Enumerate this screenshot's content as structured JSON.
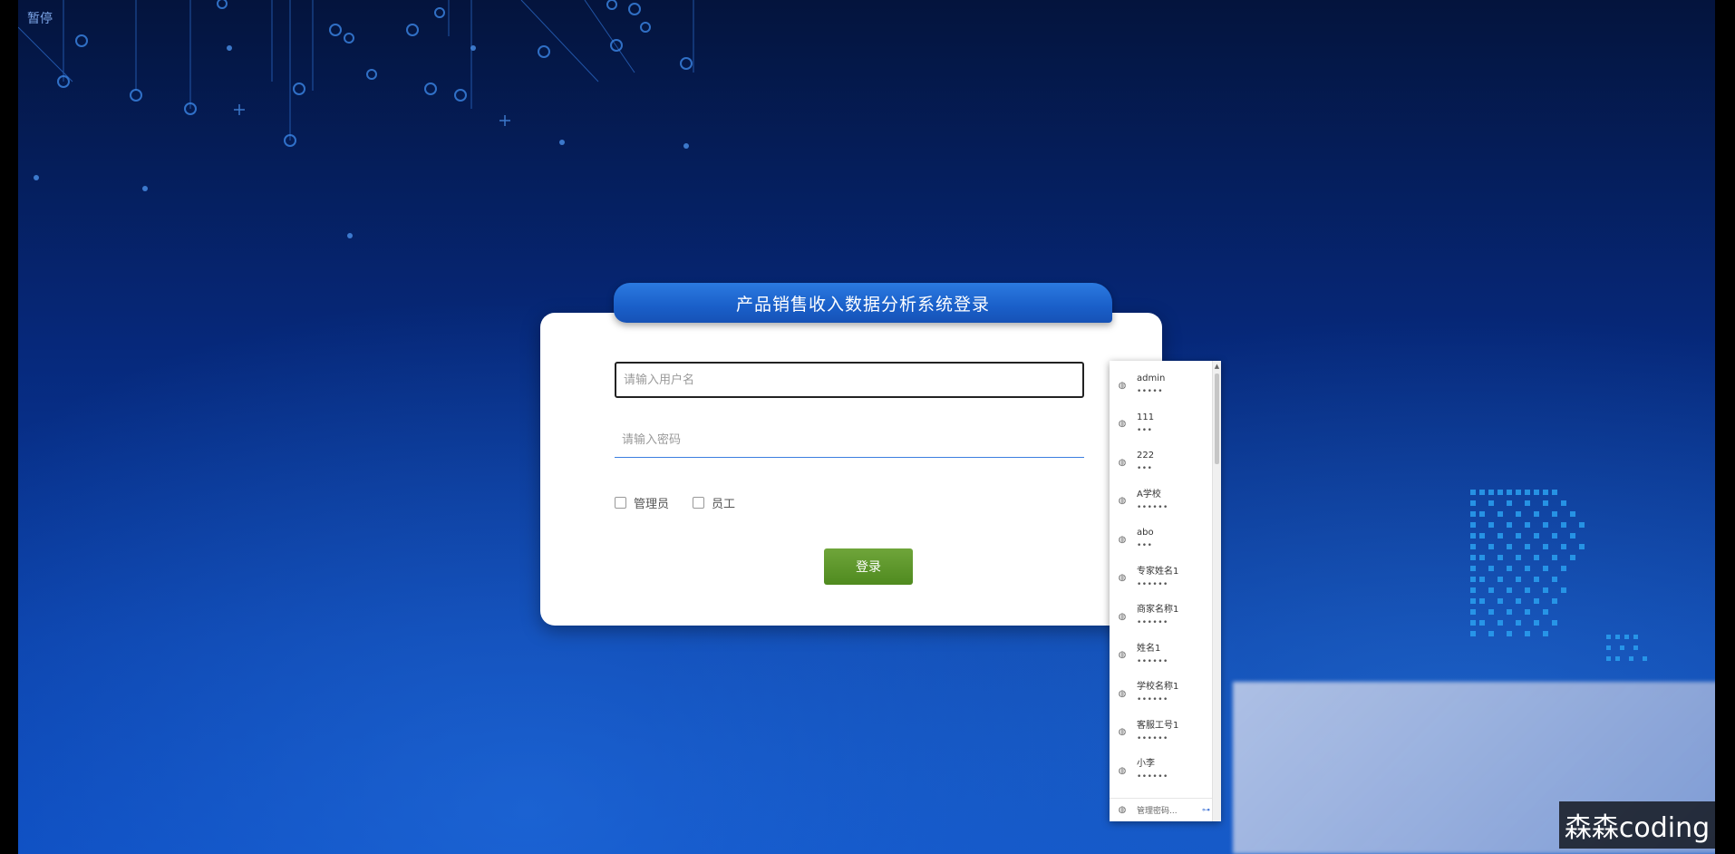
{
  "status": {
    "pause_label": "暂停"
  },
  "login": {
    "title": "产品销售收入数据分析系统登录",
    "username_placeholder": "请输入用户名",
    "password_placeholder": "请输入密码",
    "roles": [
      {
        "label": "管理员"
      },
      {
        "label": "员工"
      }
    ],
    "login_button": "登录"
  },
  "autocomplete": {
    "items": [
      {
        "username": "admin",
        "password_mask": "•••••"
      },
      {
        "username": "111",
        "password_mask": "•••"
      },
      {
        "username": "222",
        "password_mask": "•••"
      },
      {
        "username": "A学校",
        "password_mask": "••••••"
      },
      {
        "username": "abo",
        "password_mask": "•••"
      },
      {
        "username": "专家姓名1",
        "password_mask": "••••••"
      },
      {
        "username": "商家名称1",
        "password_mask": "••••••"
      },
      {
        "username": "姓名1",
        "password_mask": "••••••"
      },
      {
        "username": "学校名称1",
        "password_mask": "••••••"
      },
      {
        "username": "客服工号1",
        "password_mask": "••••••"
      },
      {
        "username": "小李",
        "password_mask": "••••••"
      }
    ],
    "footer_label": "管理密码..."
  },
  "watermark": {
    "text": "森森coding"
  },
  "colors": {
    "background": "#0a3fa8",
    "title_bar": "#1a5fc9",
    "login_button": "#5a9128"
  },
  "icons": {
    "autocomplete_item": "globe-icon",
    "autocomplete_footer": "key-icon"
  }
}
